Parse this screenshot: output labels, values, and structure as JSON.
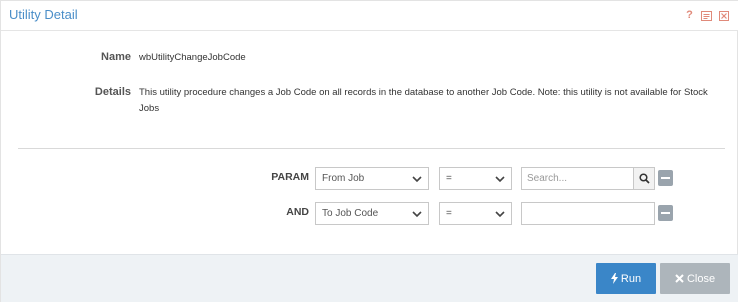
{
  "header": {
    "title": "Utility Detail",
    "icons": [
      "help-icon",
      "notes-icon",
      "close-icon"
    ],
    "help_glyph": "?"
  },
  "info": {
    "name_label": "Name",
    "name_value": "wbUtilityChangeJobCode",
    "details_label": "Details",
    "details_value": "This utility procedure changes a Job Code on all records in the database to another Job Code. Note: this utility is not available for Stock Jobs"
  },
  "params": [
    {
      "label": "PARAM",
      "field": "From Job",
      "operator": "=",
      "input_value": "",
      "input_placeholder": "Search...",
      "has_search": true
    },
    {
      "label": "AND",
      "field": "To Job Code",
      "operator": "=",
      "input_value": "",
      "input_placeholder": "",
      "has_search": false
    }
  ],
  "footer": {
    "run_label": "Run",
    "close_label": "Close"
  },
  "colors": {
    "accent": "#3a86c8",
    "title": "#4a8ec8",
    "close_button": "#adb5bb",
    "header_icons": "#e08a7a"
  }
}
